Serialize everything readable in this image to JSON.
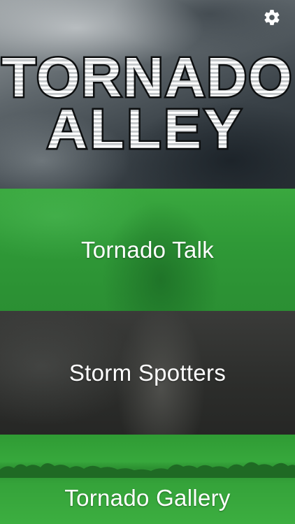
{
  "app": {
    "title_line1": "TORNADO",
    "title_line2": "ALLEY",
    "settings_icon": "gear-icon"
  },
  "menu": {
    "items": [
      {
        "label": "Tornado Talk"
      },
      {
        "label": "Storm Spotters"
      },
      {
        "label": "Tornado Gallery"
      }
    ]
  },
  "colors": {
    "menu_green": "#33a13a",
    "menu_dark": "#2c2d2b",
    "label_text": "#ffffff"
  }
}
